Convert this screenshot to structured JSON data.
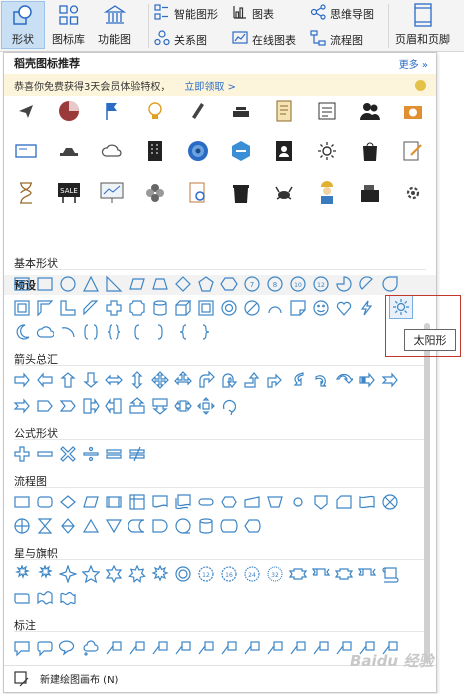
{
  "ribbon": {
    "shape_label": "形状",
    "iconlib_label": "图标库",
    "funcmap_label": "功能图",
    "smart_label": "智能图形",
    "chart_label": "图表",
    "mindmap_label": "思维导图",
    "relation_label": "关系图",
    "onlinechart_label": "在线图表",
    "flowchart_label": "流程图",
    "headerfooter_label": "页眉和页脚"
  },
  "panel": {
    "title": "稻壳图标推荐",
    "more": "更多 »",
    "promo_text": "恭喜你免费获得3天会员体验特权，",
    "promo_link": "立即领取 >",
    "presets_label": "预设",
    "sections": [
      "基本形状",
      "箭头总汇",
      "公式形状",
      "流程图",
      "星与旗帜",
      "标注"
    ],
    "footer_label": "新建绘图画布 (N)",
    "tooltip": "太阳形",
    "watermark": "Baidu 经验"
  },
  "colors": {
    "accent": "#3d86c6",
    "link": "#2a6bc5",
    "promo_bg": "#fdf5db",
    "highlight": "#c0392b"
  }
}
